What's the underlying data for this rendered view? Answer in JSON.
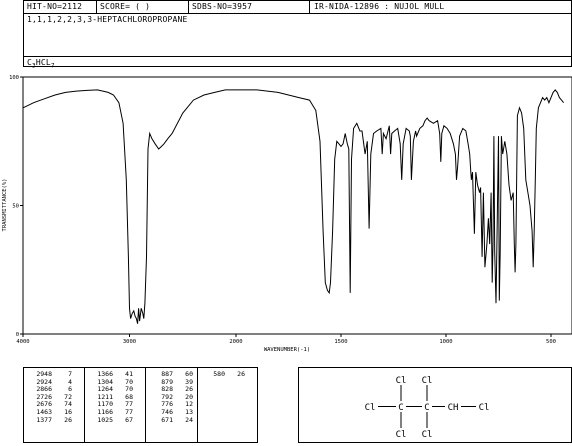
{
  "header": {
    "hit_no": "HIT-NO=2112",
    "score": "SCORE=  (  )",
    "sdbs_no": "SDBS-NO=3957",
    "ir_info": "IR-NIDA-12896 : NUJOL MULL",
    "compound_name": "1,1,1,2,2,3,3-HEPTACHLOROPROPANE",
    "formula_main": "C",
    "formula_sub1": "3",
    "formula_mid": "HCL",
    "formula_sub2": "7"
  },
  "chart_data": {
    "type": "line",
    "xlabel": "WAVENUMBER(-1)",
    "ylabel": "TRANSMITTANCE(%)",
    "xlim": [
      4000,
      400
    ],
    "ylim": [
      0,
      100
    ],
    "x_ticks": [
      {
        "value": 4000,
        "label": "4000"
      },
      {
        "value": 3000,
        "label": "3000"
      },
      {
        "value": 2000,
        "label": "2000"
      },
      {
        "value": 1500,
        "label": "1500"
      },
      {
        "value": 1000,
        "label": "1000"
      },
      {
        "value": 500,
        "label": "500"
      }
    ],
    "y_ticks": [
      {
        "value": 100,
        "label": "100"
      },
      {
        "value": 50,
        "label": "50"
      },
      {
        "value": 0,
        "label": "0"
      }
    ],
    "x": [
      4000,
      3950,
      3900,
      3800,
      3700,
      3600,
      3500,
      3400,
      3300,
      3200,
      3150,
      3100,
      3060,
      3030,
      3010,
      3000,
      2990,
      2975,
      2960,
      2948,
      2935,
      2924,
      2915,
      2905,
      2890,
      2875,
      2866,
      2855,
      2840,
      2826,
      2810,
      2790,
      2760,
      2726,
      2700,
      2676,
      2640,
      2600,
      2500,
      2400,
      2300,
      2200,
      2100,
      2000,
      1900,
      1800,
      1750,
      1700,
      1650,
      1620,
      1600,
      1585,
      1575,
      1565,
      1556,
      1550,
      1540,
      1530,
      1520,
      1510,
      1500,
      1490,
      1480,
      1470,
      1463,
      1456,
      1450,
      1440,
      1425,
      1410,
      1400,
      1385,
      1375,
      1366,
      1358,
      1345,
      1330,
      1310,
      1304,
      1298,
      1285,
      1270,
      1264,
      1258,
      1245,
      1230,
      1218,
      1211,
      1204,
      1190,
      1175,
      1170,
      1165,
      1155,
      1150,
      1145,
      1140,
      1125,
      1110,
      1100,
      1090,
      1080,
      1060,
      1040,
      1030,
      1025,
      1020,
      1010,
      995,
      980,
      965,
      955,
      950,
      945,
      935,
      920,
      905,
      895,
      887,
      882,
      879,
      874,
      865,
      858,
      850,
      840,
      835,
      828,
      822,
      815,
      805,
      798,
      792,
      785,
      780,
      776,
      772,
      768,
      762,
      758,
      750,
      746,
      742,
      736,
      730,
      720,
      710,
      700,
      690,
      680,
      675,
      671,
      667,
      660,
      650,
      640,
      630,
      620,
      610,
      600,
      590,
      585,
      580,
      575,
      570,
      560,
      550,
      540,
      530,
      520,
      510,
      500,
      490,
      480,
      470,
      460,
      450,
      440,
      430,
      420,
      410,
      400
    ],
    "y": [
      88,
      89,
      90,
      91.5,
      93,
      94,
      94.5,
      94.8,
      95,
      94,
      93,
      90,
      82,
      60,
      30,
      10,
      6,
      8,
      9,
      7,
      6,
      4,
      10,
      5,
      10,
      8,
      6,
      12,
      30,
      72,
      78,
      76,
      74,
      72,
      73,
      74,
      76,
      78,
      86,
      91,
      93,
      94,
      95,
      95,
      95,
      94,
      93,
      92,
      91,
      87,
      75,
      40,
      20,
      17,
      16,
      20,
      40,
      68,
      75,
      74,
      73,
      74,
      78,
      74,
      72,
      16,
      68,
      80,
      82,
      79,
      79,
      70,
      75,
      41,
      70,
      78,
      79,
      80,
      70,
      78,
      76,
      81,
      70,
      78,
      79,
      80,
      74,
      60,
      74,
      80,
      79,
      77,
      60,
      75,
      77,
      79,
      77,
      80,
      81,
      83,
      84,
      83,
      82,
      83,
      78,
      67,
      78,
      81,
      80,
      78,
      74,
      70,
      60,
      65,
      77,
      80,
      79,
      74,
      70,
      63,
      60,
      63,
      39,
      63,
      58,
      55,
      57,
      30,
      55,
      26,
      35,
      45,
      35,
      55,
      20,
      35,
      77,
      32,
      12,
      32,
      77,
      13,
      32,
      77,
      70,
      75,
      70,
      58,
      52,
      55,
      35,
      24,
      35,
      85,
      88,
      86,
      80,
      60,
      55,
      50,
      40,
      26,
      40,
      60,
      80,
      88,
      90,
      92,
      91,
      92,
      90,
      92,
      94,
      95,
      94,
      92,
      91,
      90
    ]
  },
  "peak_table": {
    "col1": [
      {
        "wn": "2948",
        "t": "7"
      },
      {
        "wn": "2924",
        "t": "4"
      },
      {
        "wn": "2866",
        "t": "6"
      },
      {
        "wn": "2726",
        "t": "72"
      },
      {
        "wn": "2676",
        "t": "74"
      },
      {
        "wn": "1463",
        "t": "16"
      },
      {
        "wn": "1377",
        "t": "26"
      }
    ],
    "col2": [
      {
        "wn": "1366",
        "t": "41"
      },
      {
        "wn": "1304",
        "t": "70"
      },
      {
        "wn": "1264",
        "t": "70"
      },
      {
        "wn": "1211",
        "t": "68"
      },
      {
        "wn": "1170",
        "t": "77"
      },
      {
        "wn": "1166",
        "t": "77"
      },
      {
        "wn": "1025",
        "t": "67"
      }
    ],
    "col3": [
      {
        "wn": "887",
        "t": "60"
      },
      {
        "wn": "879",
        "t": "39"
      },
      {
        "wn": "828",
        "t": "26"
      },
      {
        "wn": "792",
        "t": "20"
      },
      {
        "wn": "776",
        "t": "12"
      },
      {
        "wn": "746",
        "t": "13"
      },
      {
        "wn": "671",
        "t": "24"
      }
    ],
    "col4": [
      {
        "wn": "580",
        "t": "26"
      }
    ]
  },
  "structure": {
    "atom_cl": "Cl",
    "atom_c": "C",
    "atom_ch": "CH"
  }
}
